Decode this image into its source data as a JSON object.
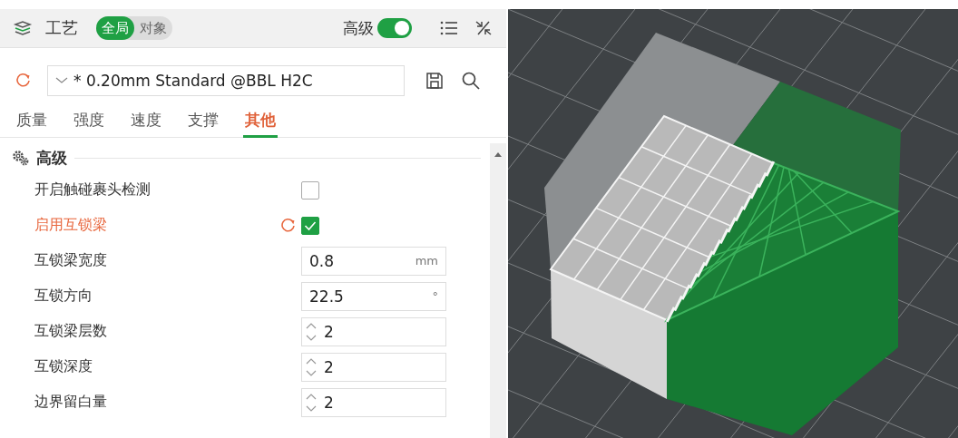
{
  "header": {
    "title": "工艺",
    "scope": [
      {
        "label": "全局",
        "selected": true
      },
      {
        "label": "对象",
        "selected": false
      }
    ],
    "advanced": {
      "label": "高级",
      "on": true
    }
  },
  "preset": {
    "value": "* 0.20mm Standard @BBL H2C",
    "modified": true
  },
  "tabs": [
    {
      "label": "质量",
      "selected": false
    },
    {
      "label": "强度",
      "selected": false
    },
    {
      "label": "速度",
      "selected": false
    },
    {
      "label": "支撑",
      "selected": false
    },
    {
      "label": "其他",
      "selected": true
    }
  ],
  "section": {
    "title": "高级",
    "settings": [
      {
        "kind": "checkbox",
        "label": "开启触碰裹头检测",
        "checked": false,
        "modified": false
      },
      {
        "kind": "checkbox",
        "label": "启用互锁梁",
        "checked": true,
        "modified": true
      },
      {
        "kind": "text",
        "label": "互锁梁宽度",
        "value": "0.8",
        "unit": "mm",
        "modified": false
      },
      {
        "kind": "text",
        "label": "互锁方向",
        "value": "22.5",
        "unit": "°",
        "modified": false
      },
      {
        "kind": "spin",
        "label": "互锁梁层数",
        "value": "2",
        "modified": false
      },
      {
        "kind": "spin",
        "label": "互锁深度",
        "value": "2",
        "modified": false
      },
      {
        "kind": "spin",
        "label": "边界留白量",
        "value": "2",
        "modified": false
      }
    ]
  }
}
